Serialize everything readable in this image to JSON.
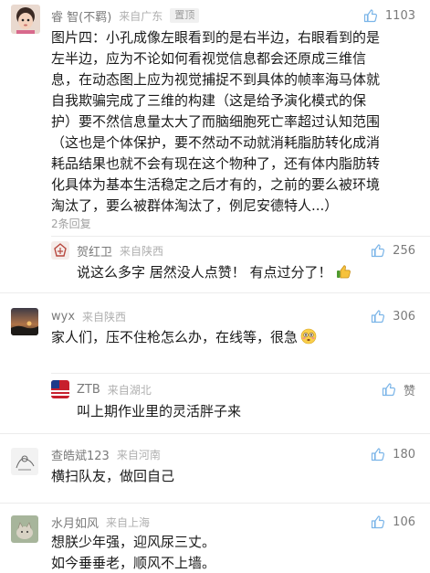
{
  "colors": {
    "like_icon": "#7bb5e8",
    "meta_text": "#7a7a7a",
    "location_text": "#b0b0b0",
    "body_text": "#1a1a1a",
    "divider": "#ececec"
  },
  "comments": [
    {
      "user": "睿 智(不羁)",
      "location": "来自广东",
      "pinned_label": "置顶",
      "likes": "1103",
      "lines": [
        "图片四：小孔成像左眼看到的是右半边，右眼看到的是",
        "左半边，应为不论如何看视觉信息都会还原成三维信",
        "息，在动态图上应为视觉捕捉不到具体的帧率海马体就",
        "自我欺骗完成了三维的构建（这是给予演化模式的保",
        "护）要不然信息量太大了而脑细胞死亡率超过认知范围",
        "（这也是个体保护，要不然动不动就消耗脂肪转化成消",
        "耗品结果也就不会有现在这个物种了，还有体内脂肪转",
        "化具体为基本生活稳定之后才有的，之前的要么被环境",
        "淘汰了，要么被群体淘汰了，例尼安德特人...）"
      ],
      "replies_label": "2条回复",
      "avatar_icon": "child-photo-avatar"
    },
    {
      "user": "贺红卫",
      "location": "来自陕西",
      "likes": "256",
      "text": "说这么多字 居然没人点赞！ 有点过分了！",
      "emoji": "thumbs-up-emoji",
      "avatar_icon": "logo-avatar"
    },
    {
      "user": "wyx",
      "location": "来自陕西",
      "likes": "306",
      "text": "家人们，压不住枪怎么办，在线等，很急",
      "emoji": "flushed-face-emoji",
      "avatar_icon": "sunset-avatar"
    },
    {
      "user": "ZTB",
      "location": "来自湖北",
      "likes": "赞",
      "text": "叫上期作业里的灵活胖子来",
      "avatar_icon": "flag-avatar"
    },
    {
      "user": "查皓斌123",
      "location": "来自河南",
      "likes": "180",
      "text": "横扫队友，做回自己",
      "avatar_icon": "sketch-avatar"
    },
    {
      "user": "水月如风",
      "location": "来自上海",
      "likes": "106",
      "lines": [
        "想朕少年强，迎风尿三丈。",
        "如今垂垂老，顺风不上墙。"
      ],
      "avatar_icon": "cat-avatar"
    }
  ]
}
